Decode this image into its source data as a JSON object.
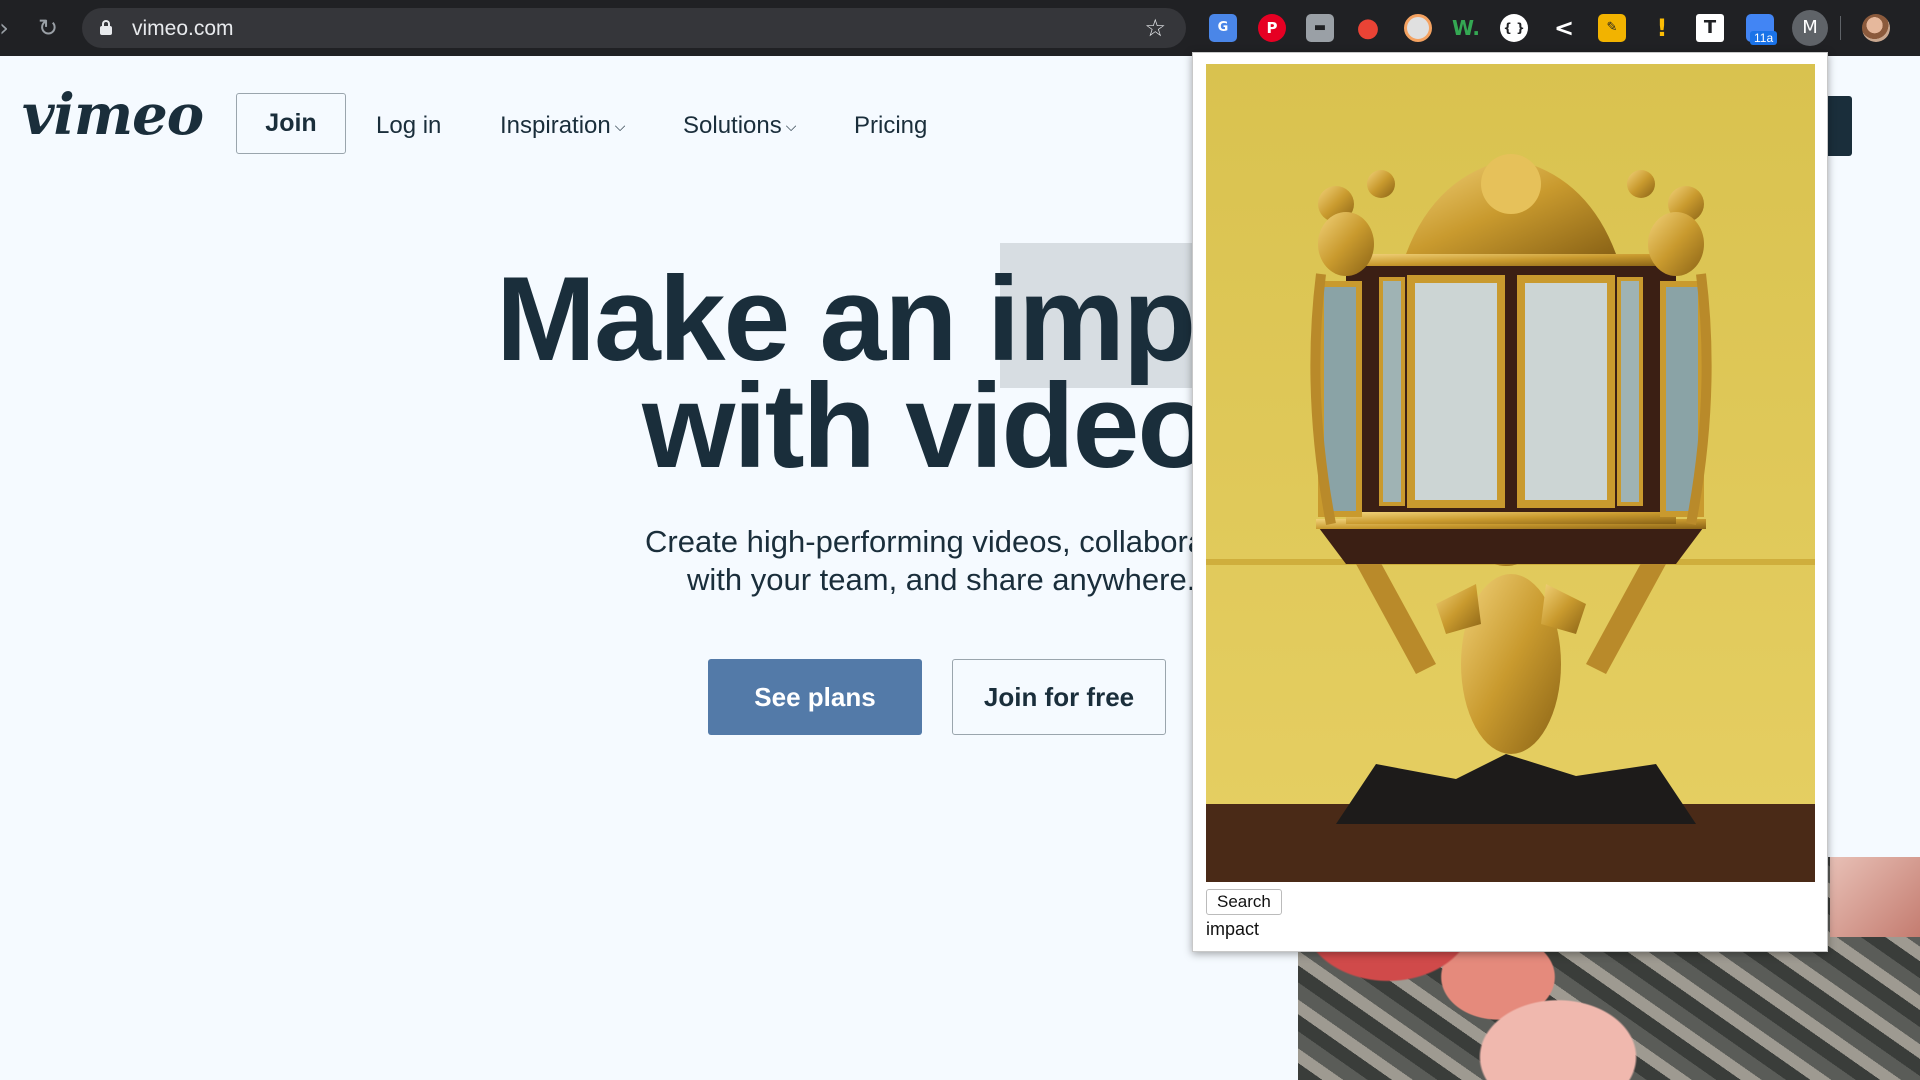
{
  "browser": {
    "url": "vimeo.com",
    "forward_icon": "forward-arrow-icon",
    "reload_icon": "reload-icon",
    "bookmark_icon": "star-icon",
    "extensions": [
      "google-translate-icon",
      "pinterest-icon",
      "dashlane-icon",
      "maps-pin-icon",
      "image-search-icon",
      "grammar-w-icon",
      "circle-brackets-icon",
      "back-chevron-icon",
      "pen-icon",
      "warning-triangle-icon",
      "text-t-icon",
      "calendar-icon",
      "m-extension-icon"
    ],
    "extension_labels": {
      "pinterest": "P",
      "grammar_w": "W.",
      "circle_brackets": "{ }",
      "back_chevron": "<",
      "warning": "!",
      "text_t": "T",
      "calendar_badge": "11a",
      "m_extension": "M"
    }
  },
  "page": {
    "logo": "vimeo",
    "nav": {
      "join": "Join",
      "login": "Log in",
      "inspiration": "Inspiration",
      "solutions": "Solutions",
      "pricing": "Pricing"
    },
    "hero": {
      "line1": "Make an imp",
      "line2": "with video",
      "sub1": "Create high-performing videos, collabora",
      "sub2": "with your team, and share anywhere."
    },
    "buttons": {
      "see_plans": "See plans",
      "join_free": "Join for free"
    }
  },
  "popup": {
    "search_label": "Search",
    "query": "impact"
  },
  "colors": {
    "chrome_bg": "#202124",
    "page_bg": "#f5faff",
    "heading": "#1a2e3b",
    "primary_button": "#537aa8",
    "popup_wall": "#e1c85a",
    "gold": "#c99a2e"
  }
}
